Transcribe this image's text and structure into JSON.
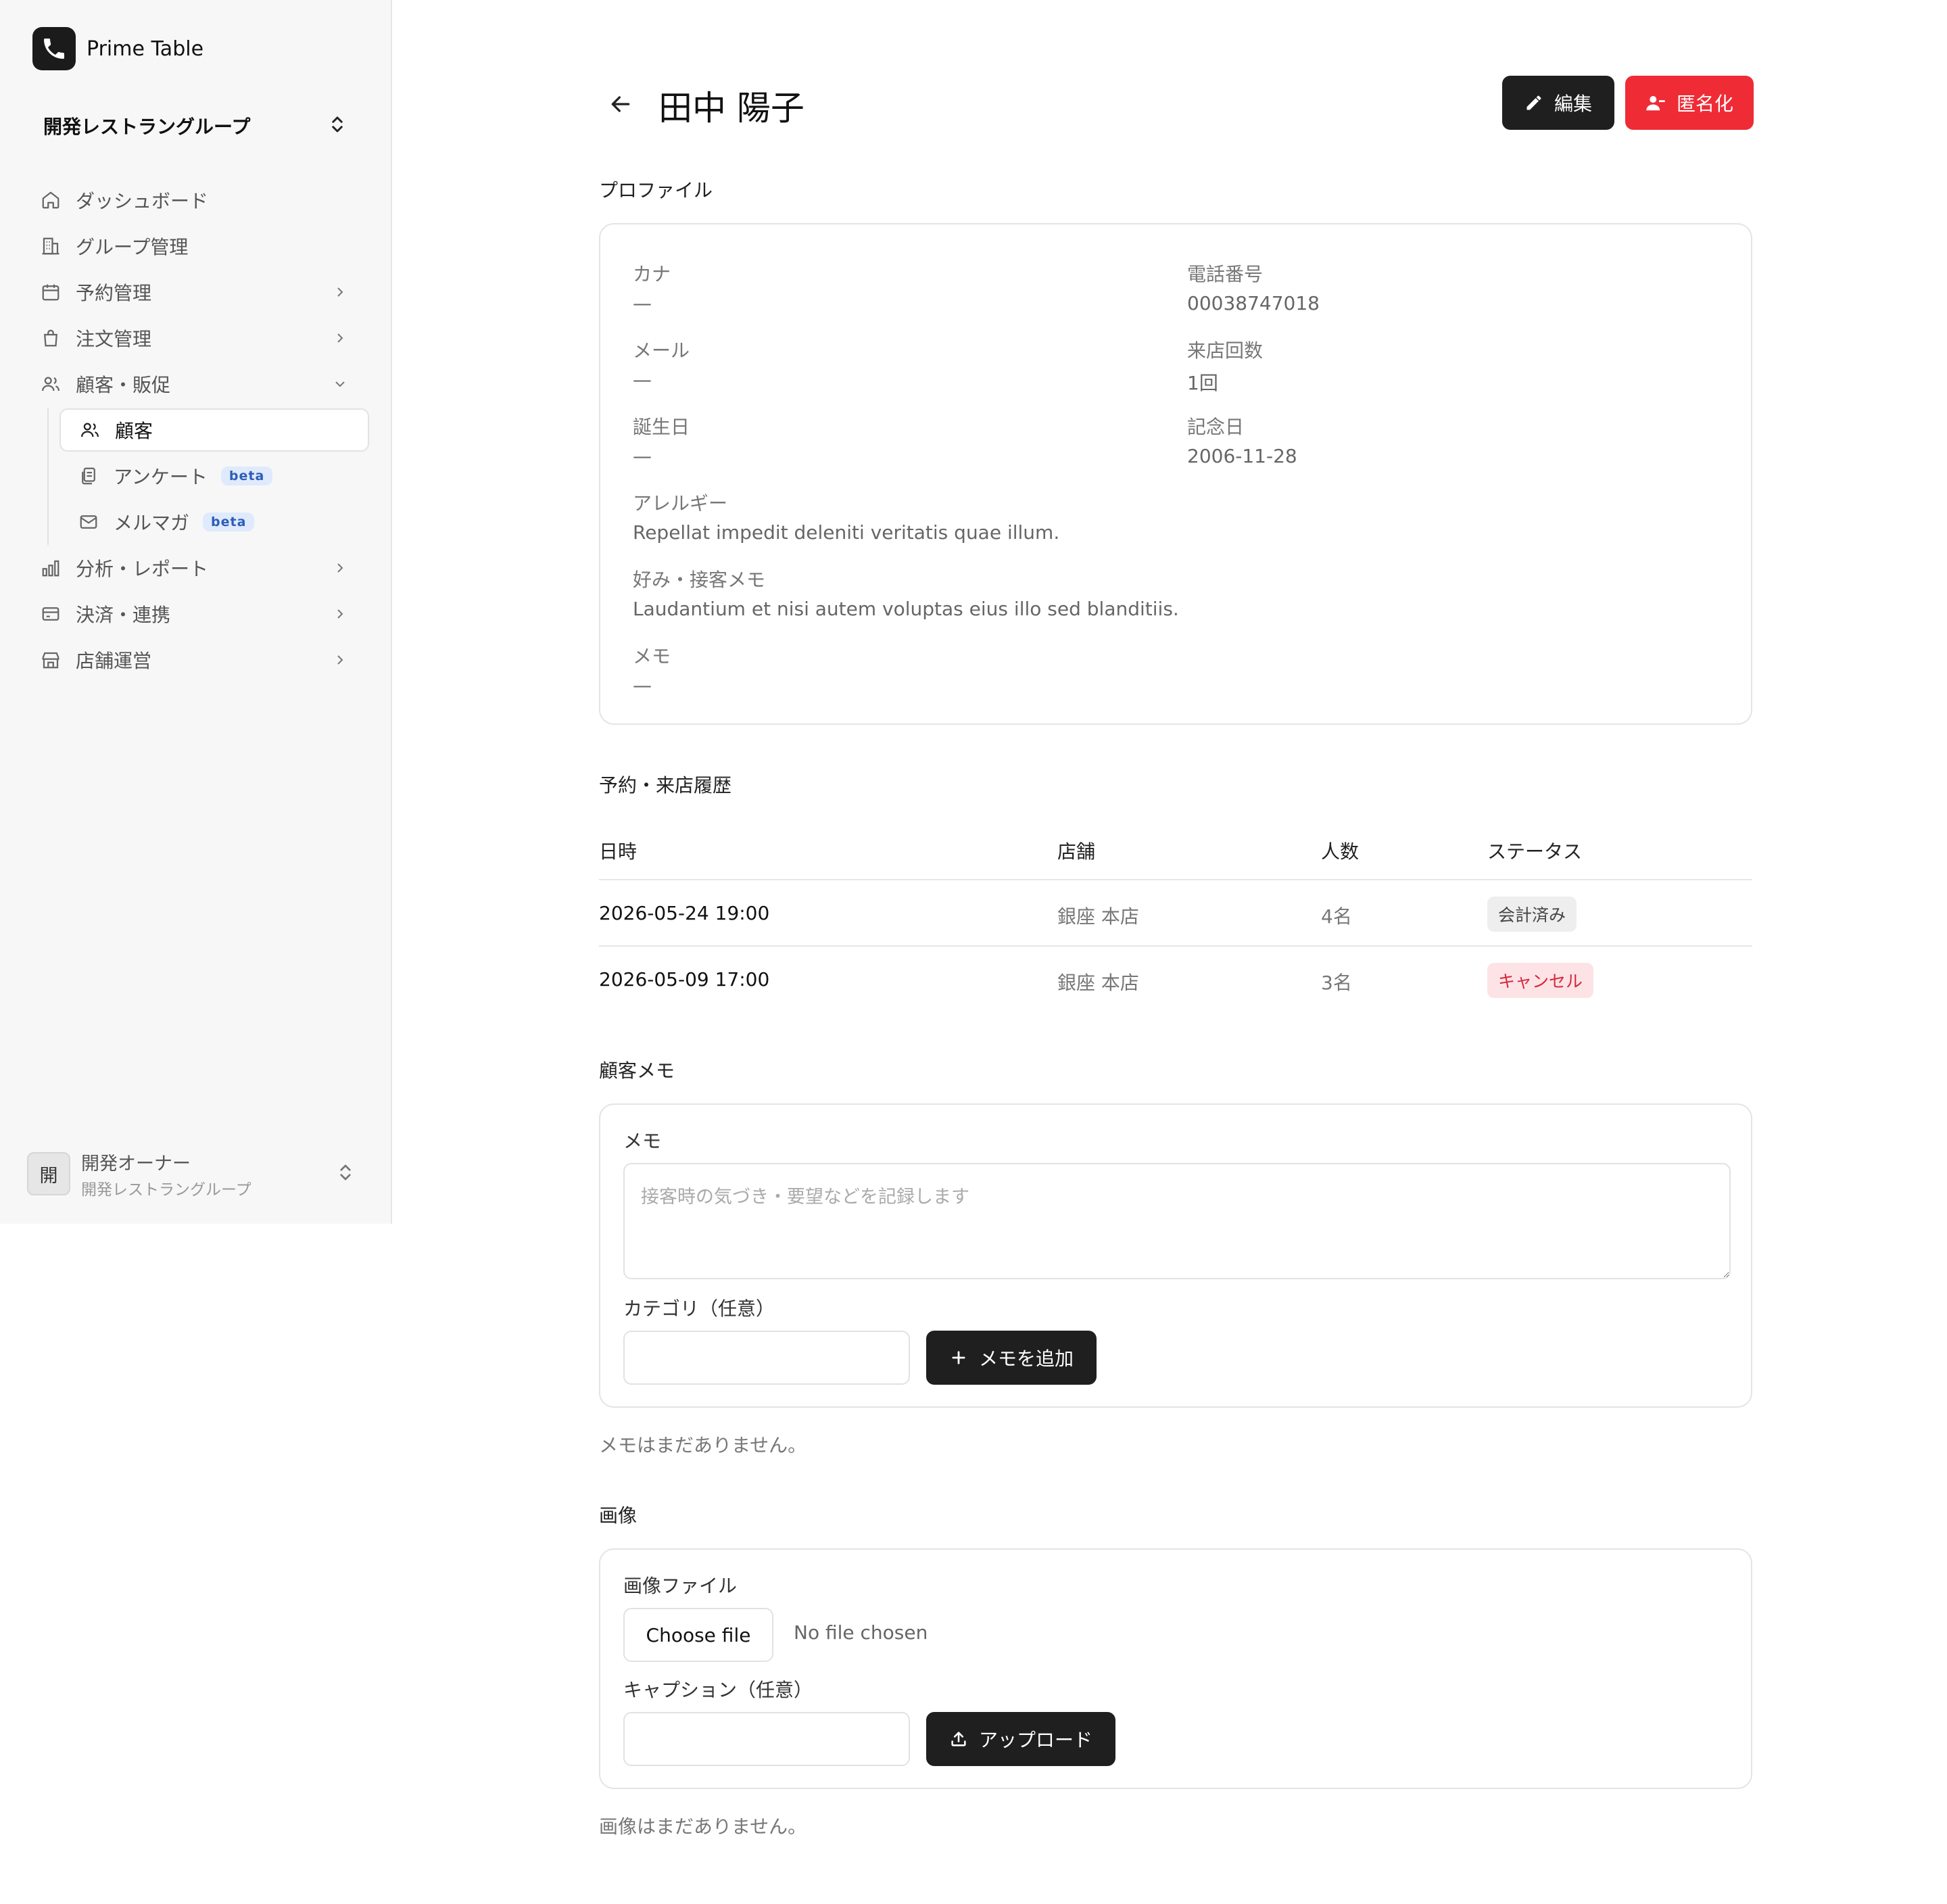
{
  "app": {
    "name": "Prime Table"
  },
  "org_switcher": {
    "name": "開発レストラングループ"
  },
  "nav": {
    "dashboard": "ダッシュボード",
    "group": "グループ管理",
    "reservations": "予約管理",
    "orders": "注文管理",
    "customers_promo": "顧客・販促",
    "customers": "顧客",
    "surveys": "アンケート",
    "newsletter": "メルマガ",
    "beta": "beta",
    "analytics": "分析・レポート",
    "payments": "決済・連携",
    "store_ops": "店舗運営"
  },
  "user": {
    "name": "開発オーナー",
    "org": "開発レストラングループ",
    "initial": "開"
  },
  "header": {
    "title": "田中 陽子",
    "edit_label": "編集",
    "anonymize_label": "匿名化"
  },
  "profile": {
    "section_title": "プロファイル",
    "kana_label": "カナ",
    "kana_value": "—",
    "phone_label": "電話番号",
    "phone_value": "00038747018",
    "email_label": "メール",
    "email_value": "—",
    "visits_label": "来店回数",
    "visits_value": "1回",
    "birthday_label": "誕生日",
    "birthday_value": "—",
    "anniversary_label": "記念日",
    "anniversary_value": "2006-11-28",
    "allergy_label": "アレルギー",
    "allergy_value": "Repellat impedit deleniti veritatis quae illum.",
    "pref_label": "好み・接客メモ",
    "pref_value": "Laudantium et nisi autem voluptas eius illo sed blanditiis.",
    "memo_label": "メモ",
    "memo_value": "—"
  },
  "history": {
    "section_title": "予約・来店履歴",
    "columns": {
      "datetime": "日時",
      "store": "店舗",
      "party": "人数",
      "status": "ステータス"
    },
    "rows": [
      {
        "datetime": "2026-05-24 19:00",
        "store": "銀座 本店",
        "party": "4名",
        "status": "会計済み"
      },
      {
        "datetime": "2026-05-09 17:00",
        "store": "銀座 本店",
        "party": "3名",
        "status": "キャンセル"
      }
    ]
  },
  "notes": {
    "section_title": "顧客メモ",
    "memo_label": "メモ",
    "memo_placeholder": "接客時の気づき・要望などを記録します",
    "memo_value": "",
    "category_label": "カテゴリ（任意）",
    "category_value": "",
    "add_label": "メモを追加",
    "empty": "メモはまだありません。"
  },
  "images": {
    "section_title": "画像",
    "file_label": "画像ファイル",
    "choose_label": "Choose file",
    "no_file": "No file chosen",
    "caption_label": "キャプション（任意）",
    "caption_value": "",
    "upload_label": "アップロード",
    "empty": "画像はまだありません。"
  },
  "colors": {
    "primary_dark": "#1f1f1f",
    "danger": "#ef2b36",
    "status_cancel": "#d4283a"
  }
}
